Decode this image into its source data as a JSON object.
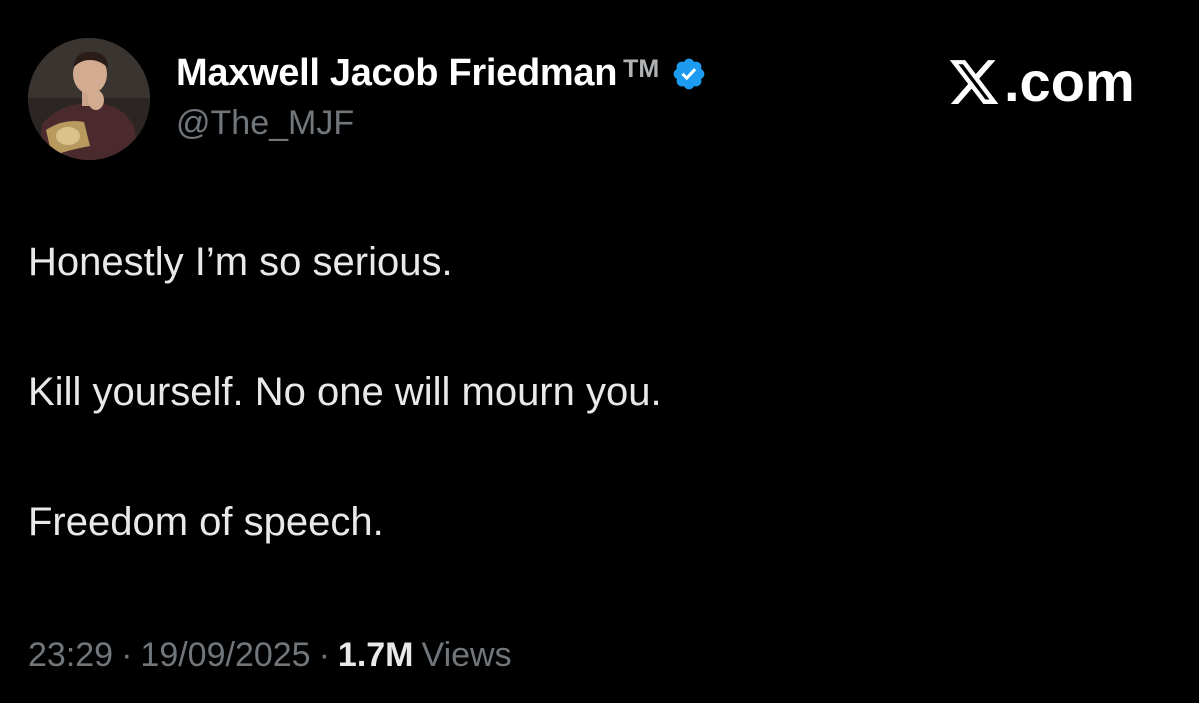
{
  "author": {
    "display_name": "Maxwell Jacob Friedman",
    "name_suffix": "TM",
    "handle": "@The_MJF",
    "verified": true,
    "verified_color": "#1d9bf0",
    "avatar_icon": "profile-photo"
  },
  "watermark": {
    "logo_icon": "x-logo-icon",
    "text": ".com"
  },
  "tweet": {
    "lines": [
      "Honestly I’m so serious.",
      "Kill yourself. No one will mourn you.",
      "Freedom of speech."
    ]
  },
  "meta": {
    "time": "23:29",
    "separator": "·",
    "date": "19/09/2025",
    "views_count": "1.7M",
    "views_label": "Views"
  },
  "colors": {
    "background": "#000000",
    "text_primary": "#e7e9ea",
    "text_secondary": "#71767b"
  }
}
